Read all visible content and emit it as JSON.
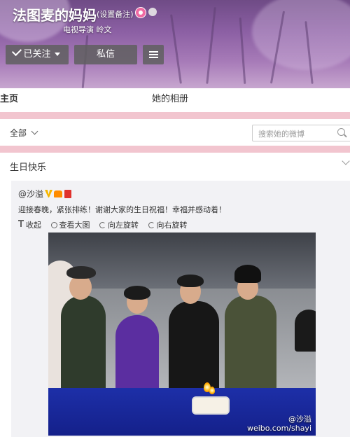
{
  "profile": {
    "name": "法图麦的妈妈",
    "remark_link": "(设置备注)",
    "subtitle": "电视导演 岭文"
  },
  "actions": {
    "follow_label": "已关注",
    "message_label": "私信"
  },
  "tabs": [
    {
      "label": "主页",
      "active": true
    },
    {
      "label": "她的相册",
      "active": false
    }
  ],
  "filter": {
    "selected": "全部",
    "search_placeholder": "搜索她的微博"
  },
  "card": {
    "title": "生日快乐"
  },
  "repost": {
    "author": "@沙溢",
    "text": "迎接春晚，紧张排练！谢谢大家的生日祝福！幸福并感动着！",
    "actions": [
      "收起",
      "查看大图",
      "向左旋转",
      "向右旋转"
    ],
    "watermark_top": "@沙溢",
    "watermark_bottom": "weibo.com/shayi"
  },
  "colors": {
    "accent": "#ff8200",
    "divider_pink": "#f2c5cf",
    "table_blue": "#1d2fa8"
  }
}
